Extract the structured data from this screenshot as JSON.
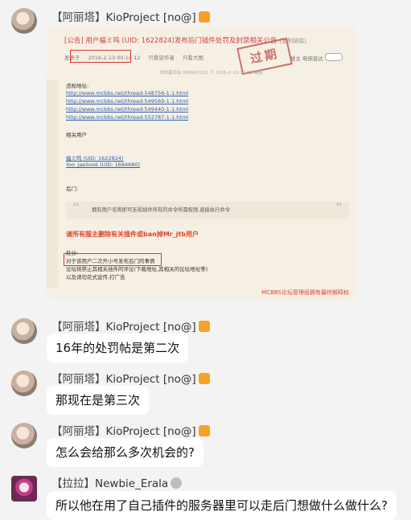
{
  "messages": [
    {
      "sender_tag": "【阿丽塔】",
      "sender_name": "KioProject [no@]",
      "badge": "🍟",
      "type": "image",
      "image": {
        "title": "[公告] 用户蝠ミ鸣 (UID: 1622824)发布后门插件处罚及封禁相关公告",
        "title_tag": "[复制链接]",
        "topbar": [
          "发表于",
          "2016-2-13 00:14:12",
          "只看该作者",
          "只看大图"
        ],
        "topright": [
          "楼主",
          "电梯直达"
        ],
        "stamp": "过期",
        "edited": "本帖最后由 999997021 于 2016-2-13 00:12 编辑",
        "links_label": "违规地址:",
        "links": [
          "http://www.mcbbs.net/thread-548756-1-1.html",
          "http://www.mcbbs.net/thread-549569-1-1.html",
          "http://www.mcbbs.net/thread-549440-1-1.html",
          "http://www.mcbbs.net/thread-552787-1-1.html"
        ],
        "users_label": "相关用户",
        "users": [
          "蝠ミ鸣 (UID: 1622824)",
          "Yoo_JaeSook (UID: 1684680)"
        ],
        "backdoor_label": "后门:",
        "quote": "拥有用户名称即可无视插件所有的命令所需权限,直接执行命令",
        "warning": "请所有服主删除有关插件或ban掉Mr_jtb用户",
        "penalty_label": "处分:",
        "penalties": [
          "对于该用户二次开小号发布后门的事情",
          "论坛将禁止其相关插件的评论(下载地址,其相关的论坛地址等)",
          "以及请勿花式宣传,打广告"
        ],
        "footer": "MCBBS论坛管理组拥有最终解释权"
      }
    },
    {
      "sender_tag": "【阿丽塔】",
      "sender_name": "KioProject [no@]",
      "badge": "🍟",
      "type": "text",
      "text": "16年的处罚帖是第二次"
    },
    {
      "sender_tag": "【阿丽塔】",
      "sender_name": "KioProject [no@]",
      "badge": "🍟",
      "type": "text",
      "text": "那现在是第三次"
    },
    {
      "sender_tag": "【阿丽塔】",
      "sender_name": "KioProject [no@]",
      "badge": "🍟",
      "type": "text",
      "text": "怎么会给那么多次机会的?"
    },
    {
      "sender_tag": "【拉拉】",
      "sender_name": "Newbie_Erala",
      "badge": "🐙",
      "type": "text",
      "text": "所以他在用了自己插件的服务器里可以走后门想做什么做什么?"
    }
  ]
}
